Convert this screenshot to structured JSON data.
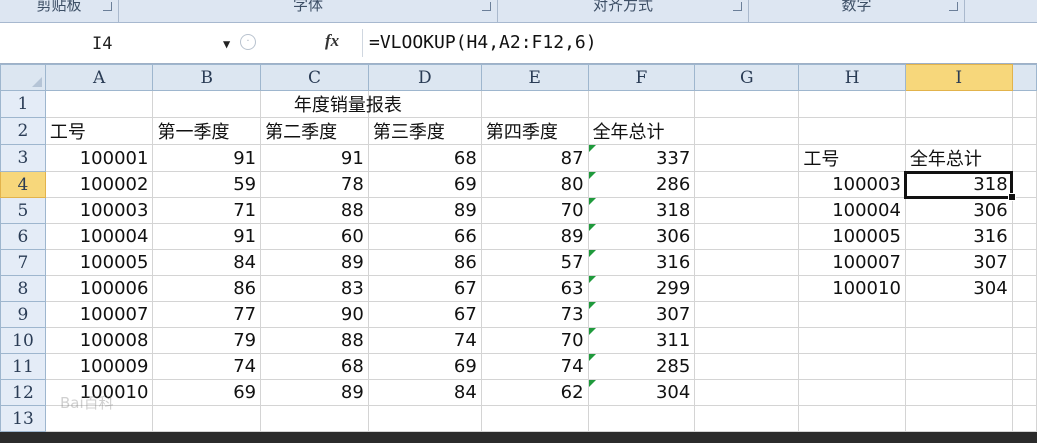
{
  "ribbon": {
    "groups": [
      "剪贴板",
      "字体",
      "对齐方式",
      "数字"
    ]
  },
  "formula_bar": {
    "name_box": "I4",
    "fx": "fx",
    "formula": "=VLOOKUP(H4,A2:F12,6)"
  },
  "columns": [
    "A",
    "B",
    "C",
    "D",
    "E",
    "F",
    "G",
    "H",
    "I"
  ],
  "rows": [
    {
      "n": "1",
      "cells": [
        "",
        "",
        "",
        "年度销量报表",
        "",
        "",
        "",
        "",
        ""
      ]
    },
    {
      "n": "2",
      "cells": [
        "工号",
        "第一季度",
        "第二季度",
        "第三季度",
        "第四季度",
        "全年总计",
        "",
        "",
        ""
      ]
    },
    {
      "n": "3",
      "cells": [
        "100001",
        "91",
        "91",
        "68",
        "87",
        "337",
        "",
        "工号",
        "全年总计"
      ]
    },
    {
      "n": "4",
      "cells": [
        "100002",
        "59",
        "78",
        "69",
        "80",
        "286",
        "",
        "100003",
        "318"
      ]
    },
    {
      "n": "5",
      "cells": [
        "100003",
        "71",
        "88",
        "89",
        "70",
        "318",
        "",
        "100004",
        "306"
      ]
    },
    {
      "n": "6",
      "cells": [
        "100004",
        "91",
        "60",
        "66",
        "89",
        "306",
        "",
        "100005",
        "316"
      ]
    },
    {
      "n": "7",
      "cells": [
        "100005",
        "84",
        "89",
        "86",
        "57",
        "316",
        "",
        "100007",
        "307"
      ]
    },
    {
      "n": "8",
      "cells": [
        "100006",
        "86",
        "83",
        "67",
        "63",
        "299",
        "",
        "100010",
        "304"
      ]
    },
    {
      "n": "9",
      "cells": [
        "100007",
        "77",
        "90",
        "67",
        "73",
        "307",
        "",
        "",
        ""
      ]
    },
    {
      "n": "10",
      "cells": [
        "100008",
        "79",
        "88",
        "74",
        "70",
        "311",
        "",
        "",
        ""
      ]
    },
    {
      "n": "11",
      "cells": [
        "100009",
        "74",
        "68",
        "69",
        "74",
        "285",
        "",
        "",
        ""
      ]
    },
    {
      "n": "12",
      "cells": [
        "100010",
        "69",
        "89",
        "84",
        "62",
        "304",
        "",
        "",
        ""
      ]
    },
    {
      "n": "13",
      "cells": [
        "",
        "",
        "",
        "",
        "",
        "",
        "",
        "",
        ""
      ]
    }
  ],
  "watermark": "Bai百科"
}
